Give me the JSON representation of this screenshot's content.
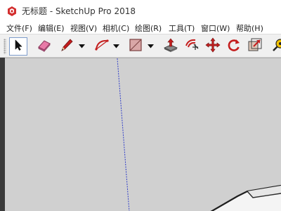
{
  "window": {
    "title": "无标题 - SketchUp Pro 2018"
  },
  "menubar": {
    "items": [
      {
        "label": "文件(F)"
      },
      {
        "label": "编辑(E)"
      },
      {
        "label": "视图(V)"
      },
      {
        "label": "相机(C)"
      },
      {
        "label": "绘图(R)"
      },
      {
        "label": "工具(T)"
      },
      {
        "label": "窗口(W)"
      },
      {
        "label": "帮助(H)"
      }
    ]
  },
  "toolbar": {
    "tools": [
      {
        "icon": "select-arrow-icon",
        "active": true
      },
      {
        "icon": "eraser-icon"
      },
      {
        "icon": "pencil-line-icon",
        "has_dropdown": true
      },
      {
        "icon": "arc-icon",
        "has_dropdown": true
      },
      {
        "icon": "rectangle-icon",
        "has_dropdown": true
      },
      {
        "icon": "push-pull-icon"
      },
      {
        "icon": "offset-icon"
      },
      {
        "icon": "move-icon"
      },
      {
        "icon": "rotate-icon"
      },
      {
        "icon": "scale-icon"
      },
      {
        "icon": "tape-measure-icon"
      }
    ]
  },
  "colors": {
    "viewport_background": "#d0d0d0",
    "toolbar_background": "#f0f0f0",
    "blue_axis": "#2e3cc8",
    "model_dark": "#1e1e1e",
    "model_light": "#f4f4f4",
    "eraser_pink": "#e87aa8",
    "pencil_red": "#c41e1e",
    "logo_red": "#d32f2f"
  }
}
